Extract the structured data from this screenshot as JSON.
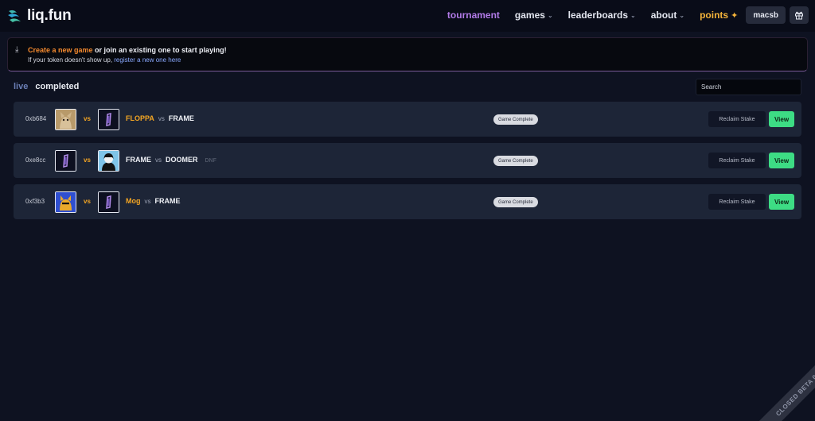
{
  "app": {
    "name": "liq.fun"
  },
  "nav": {
    "tournament": "tournament",
    "games": "games",
    "leaderboards": "leaderboards",
    "about": "about",
    "points": "points",
    "user": "macsb",
    "icons": {
      "dropdown": "chevron-down-icon",
      "points": "sparkle-icon",
      "gift": "gift-icon"
    }
  },
  "banner": {
    "icon": "download-icon",
    "create_link": "Create a new game",
    "line1_rest": " or join an existing one to start playing!",
    "line2_prefix": "If your token doesn't show up, ",
    "register_link": "register a new one here"
  },
  "tabs": {
    "live": "live",
    "completed": "completed",
    "active": "completed"
  },
  "search": {
    "placeholder": "Search",
    "value": ""
  },
  "rows": [
    {
      "id": "0xb684",
      "player1": "FLOPPA",
      "vs": "vs",
      "player2": "FRAME",
      "dnf": "",
      "status": "Game Complete",
      "reclaim": "Reclaim Stake",
      "view": "View",
      "vs_icon": "vs"
    },
    {
      "id": "0xe8cc",
      "player1": "FRAME",
      "vs": "vs",
      "player2": "DOOMER",
      "dnf": "DNF",
      "status": "Game Complete",
      "reclaim": "Reclaim Stake",
      "view": "View",
      "vs_icon": "vs"
    },
    {
      "id": "0xf3b3",
      "player1": "Mog",
      "vs": "vs",
      "player2": "FRAME",
      "dnf": "",
      "status": "Game Complete",
      "reclaim": "Reclaim Stake",
      "view": "View",
      "vs_icon": "vs"
    }
  ],
  "colors": {
    "accent_orange": "#f5a623",
    "accent_purple": "#b27be8",
    "view_green": "#3ddc84",
    "background": "#0e1221"
  },
  "beta_label": "CLOSED BETA 0.0.2"
}
